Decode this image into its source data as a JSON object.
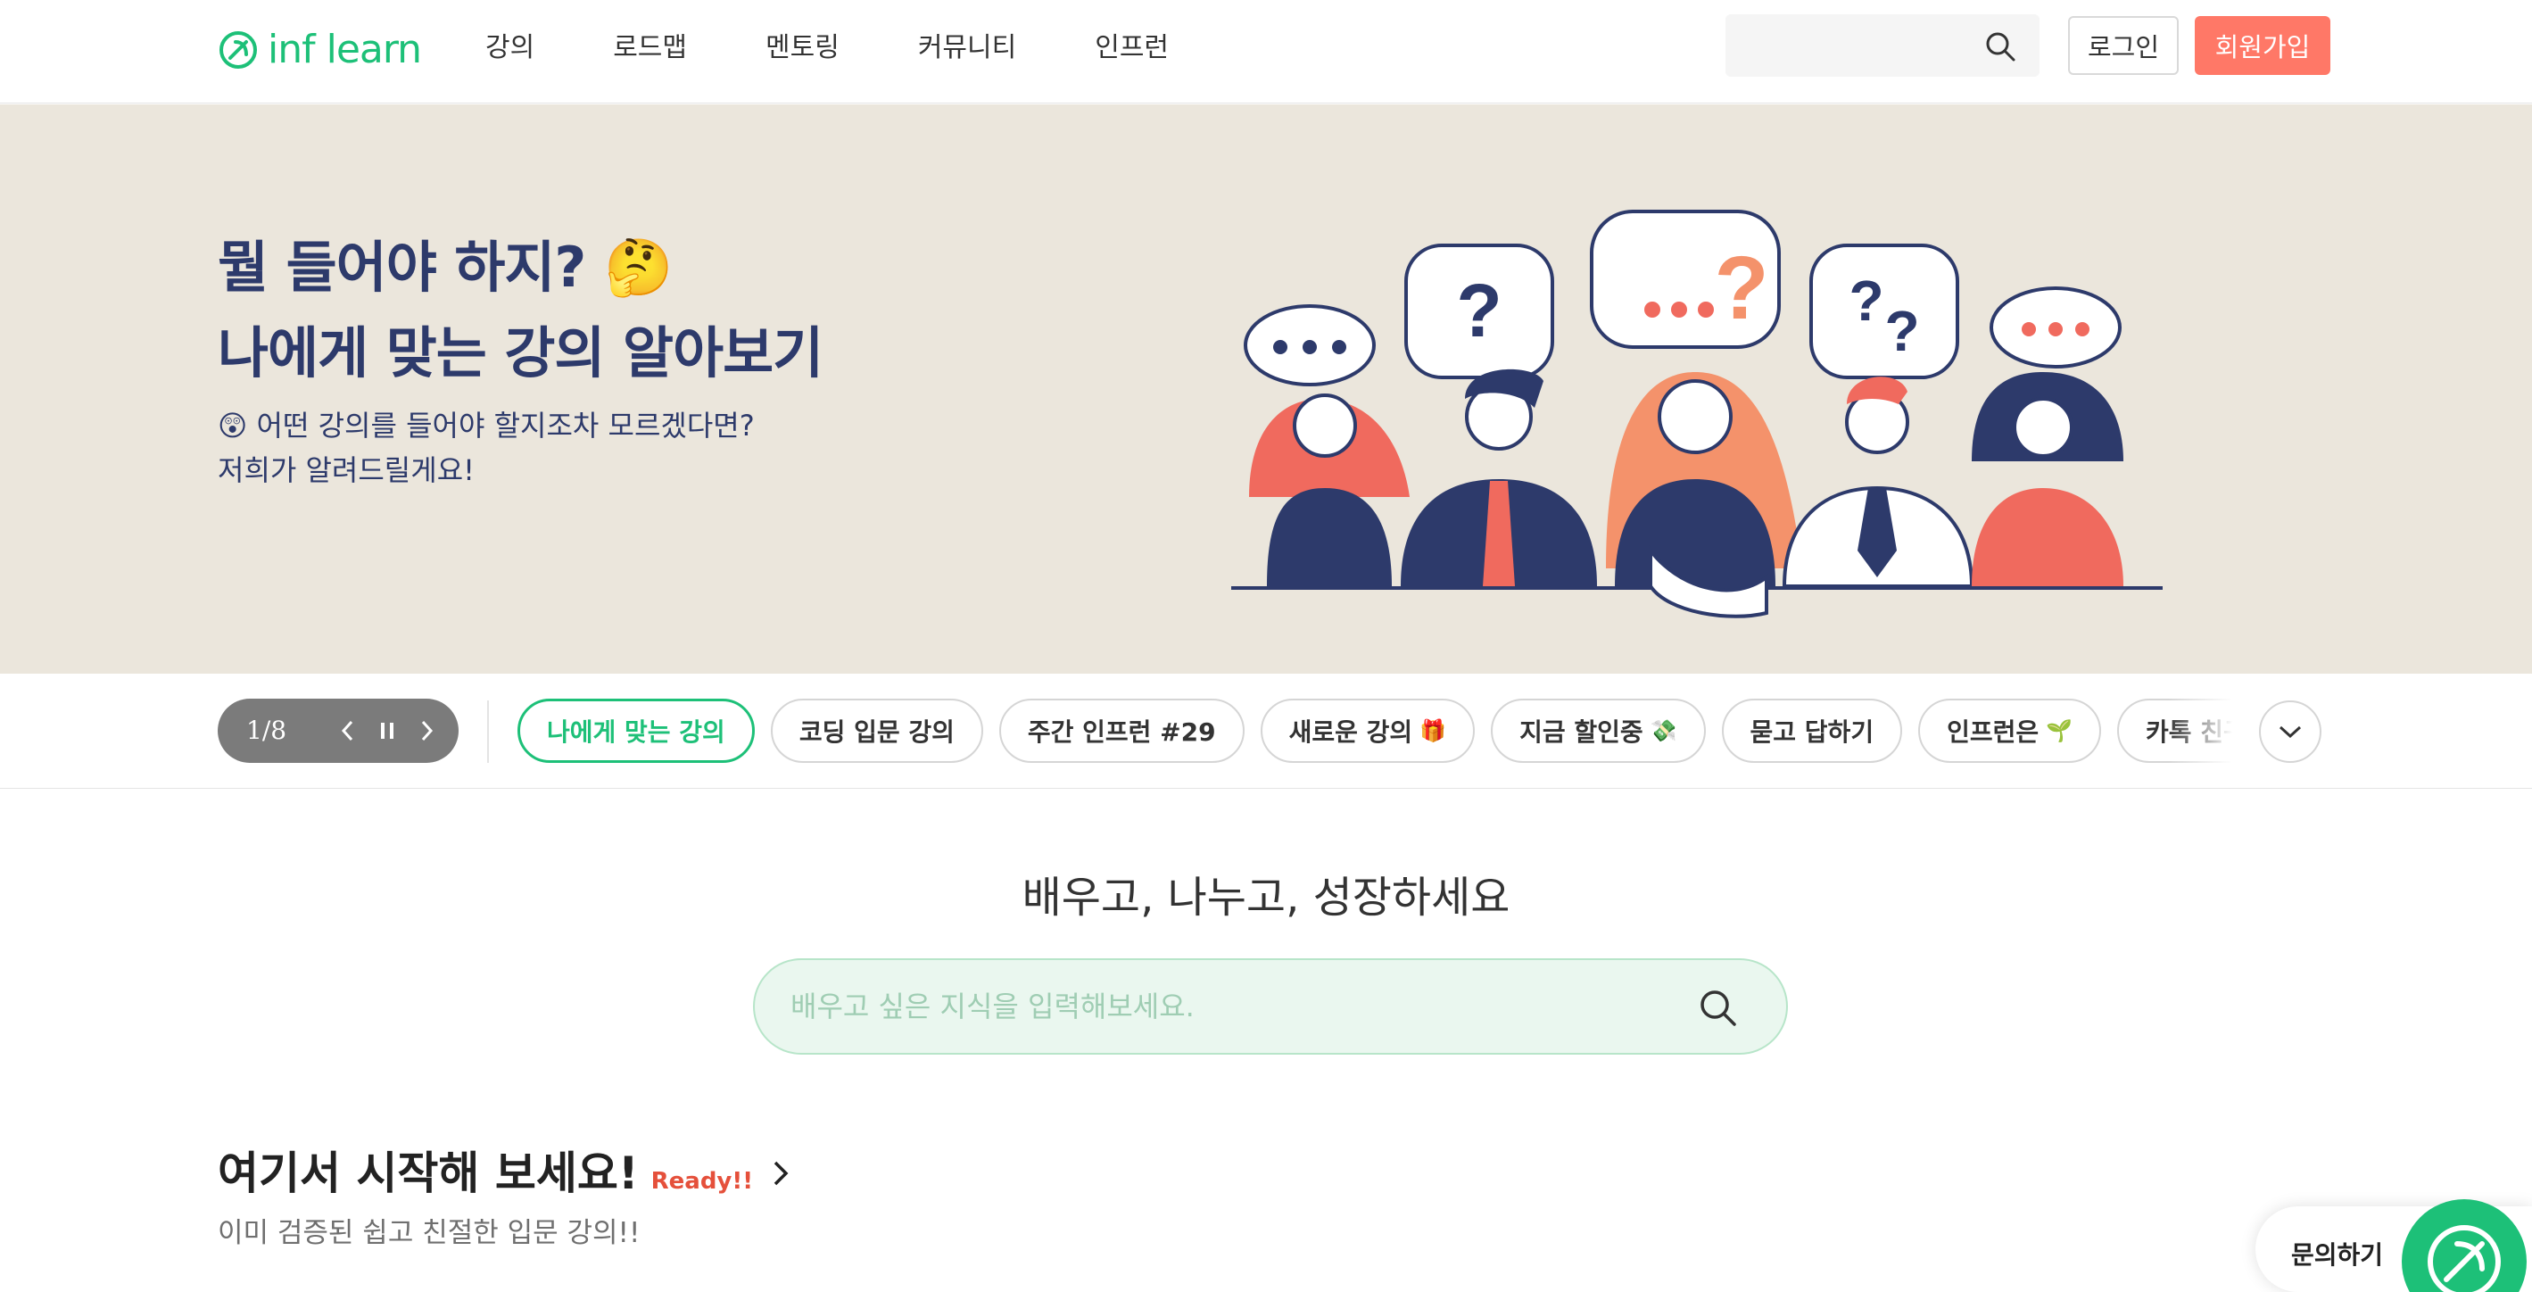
{
  "header": {
    "logo_text": "inf learn",
    "nav": [
      "강의",
      "로드맵",
      "멘토링",
      "커뮤니티",
      "인프런"
    ],
    "search_placeholder": "",
    "login_label": "로그인",
    "signup_label": "회원가입"
  },
  "hero": {
    "title_line1": "뭘 들어야 하지? 🤔",
    "title_line2": "나에게 맞는 강의 알아보기",
    "sub_line1": "😲 어떤 강의를 들어야 할지조차 모르겠다면?",
    "sub_line2": "저희가 알려드릴게요!"
  },
  "carousel": {
    "counter": "1/8",
    "chips": [
      {
        "label": "나에게 맞는 강의",
        "emoji": "",
        "active": true
      },
      {
        "label": "코딩 입문 강의",
        "emoji": "",
        "active": false
      },
      {
        "label": "주간 인프런 #29",
        "emoji": "",
        "active": false
      },
      {
        "label": "새로운 강의",
        "emoji": "🎁",
        "active": false
      },
      {
        "label": "지금 할인중",
        "emoji": "💸",
        "active": false
      },
      {
        "label": "묻고 답하기",
        "emoji": "",
        "active": false
      },
      {
        "label": "인프런은",
        "emoji": "🌱",
        "active": false
      },
      {
        "label": "카톡 친구 할",
        "emoji": "",
        "active": false
      }
    ]
  },
  "main": {
    "heading": "배우고, 나누고, 성장하세요",
    "search_placeholder": "배우고 싶은 지식을 입력해보세요."
  },
  "section": {
    "title": "여기서 시작해 보세요!",
    "badge": "Ready!!",
    "subtitle": "이미 검증된 쉽고 친절한 입문 강의!!"
  },
  "inquiry": {
    "label": "문의하기"
  },
  "colors": {
    "brand_green": "#1dc078",
    "signup_coral": "#ff7867",
    "hero_bg": "#ebe6dc",
    "hero_navy": "#2d3a6b",
    "ready_red": "#e5503b"
  }
}
